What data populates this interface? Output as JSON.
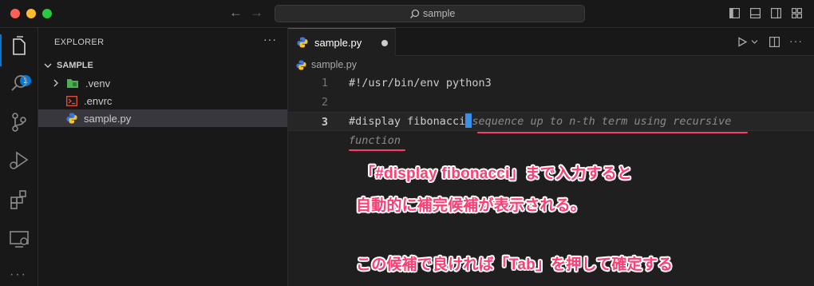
{
  "window": {
    "search_text": "sample",
    "traffic_colors": {
      "close": "#ff5f57",
      "minimize": "#febc2e",
      "maximize": "#28c840"
    }
  },
  "activity_bar": {
    "explorer_badge": "1",
    "icons": [
      "files-icon",
      "search-icon",
      "source-control-icon",
      "run-debug-icon",
      "extensions-icon",
      "remote-explorer-icon",
      "more-icon"
    ]
  },
  "sidebar": {
    "title": "EXPLORER",
    "more": "···",
    "section": "SAMPLE",
    "items": [
      {
        "label": ".venv",
        "icon": "folder-icon"
      },
      {
        "label": ".envrc",
        "icon": "terminal-file-icon"
      },
      {
        "label": "sample.py",
        "icon": "python-icon"
      }
    ]
  },
  "editor": {
    "tab_label": "sample.py",
    "breadcrumb": "sample.py",
    "lines": [
      {
        "num": "1",
        "text": "#!/usr/bin/env python3"
      },
      {
        "num": "2",
        "text": ""
      },
      {
        "num": "3",
        "text": "#display fibonacci",
        "ghost": "sequence up to n-th term using recursive"
      },
      {
        "num": "",
        "text": "",
        "ghost": "function"
      }
    ]
  },
  "annotations": {
    "line1": "「#display fibonacci」まで入力すると",
    "line2": "自動的に補完候補が表示される。",
    "line3": "この候補で良ければ「Tab」を押して確定する"
  },
  "colors": {
    "accent": "#0078d4",
    "annotation": "#ff3d73",
    "cursor": "#3b8eea"
  }
}
